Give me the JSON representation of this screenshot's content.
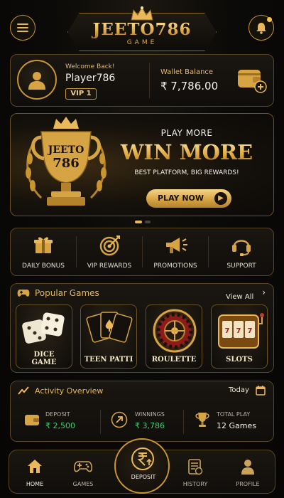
{
  "header": {
    "logo_main": "JEETO786",
    "logo_sub": "GAME"
  },
  "user": {
    "welcome": "Welcome Back!",
    "name": "Player786",
    "vip": "VIP 1",
    "wallet_label": "Wallet Balance",
    "wallet_value": "₹ 7,786.00"
  },
  "banner": {
    "trophy_text_1": "JEETO",
    "trophy_text_2": "786",
    "headline_small": "PLAY MORE",
    "headline_big": "WIN MORE",
    "tagline": "BEST PLATFORM, BIG REWARDS!",
    "cta": "PLAY NOW",
    "dots_active": 1,
    "dots_total": 2
  },
  "categories": [
    {
      "label": "DAILY BONUS",
      "icon": "gift-icon"
    },
    {
      "label": "VIP REWARDS",
      "icon": "target-icon"
    },
    {
      "label": "PROMOTIONS",
      "icon": "megaphone-icon"
    },
    {
      "label": "SUPPORT",
      "icon": "headset-icon"
    }
  ],
  "popular": {
    "title": "Popular Games",
    "view_all": "View All",
    "games": [
      {
        "label_1": "DICE",
        "label_2": "GAME"
      },
      {
        "label_1": "TEEN PATTI",
        "label_2": ""
      },
      {
        "label_1": "ROULETTE",
        "label_2": ""
      },
      {
        "label_1": "SLOTS",
        "label_2": ""
      }
    ]
  },
  "activity": {
    "title": "Activity Overview",
    "period": "Today",
    "stats": [
      {
        "label": "DEPOSIT",
        "value": "₹ 2,500"
      },
      {
        "label": "WINNINGS",
        "value": "₹ 3,786"
      },
      {
        "label": "TOTAL PLAY",
        "value": "12 Games"
      }
    ]
  },
  "nav": {
    "home": "HOME",
    "games": "GAMES",
    "deposit": "DEPOSIT",
    "history": "HISTORY",
    "profile": "PROFILE"
  },
  "colors": {
    "accent": "#e8b85a",
    "positive": "#3fd16a"
  }
}
